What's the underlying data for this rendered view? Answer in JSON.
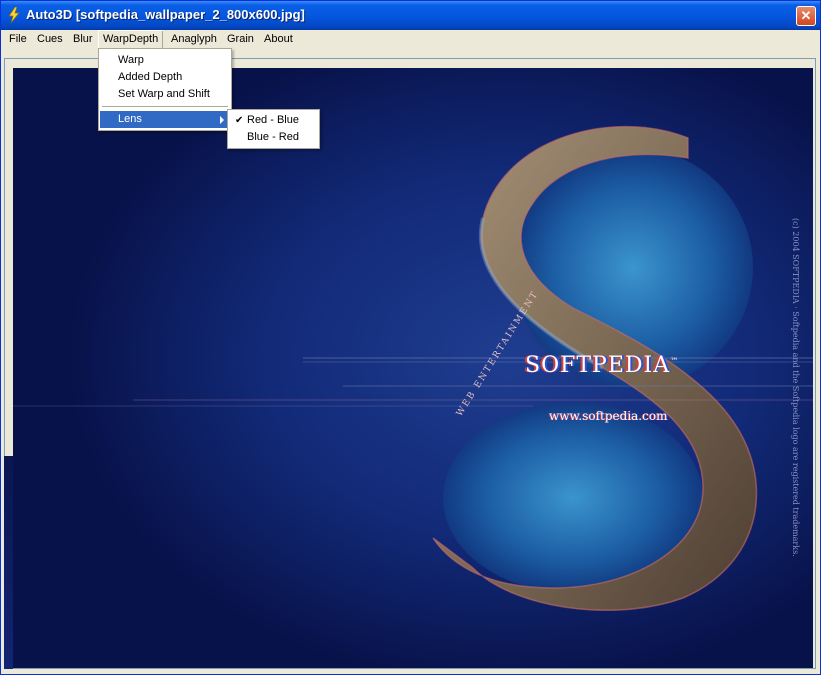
{
  "window": {
    "title": "Auto3D [softpedia_wallpaper_2_800x600.jpg]"
  },
  "menubar": {
    "items": [
      "File",
      "Cues",
      "Blur",
      "WarpDepth",
      "Anaglyph",
      "Grain",
      "About"
    ]
  },
  "warpdepth_menu": {
    "items": [
      "Warp",
      "Added Depth",
      "Set Warp and Shift"
    ],
    "lens_label": "Lens"
  },
  "lens_submenu": {
    "items": [
      "Red - Blue",
      "Blue - Red"
    ],
    "checked": "Red - Blue"
  },
  "wallpaper": {
    "brand": "SOFTPEDIA",
    "trademark": "™",
    "url": "www.softpedia.com",
    "tagline": "WEB ENTERTAINMENT",
    "legal": "(c) 2004 SOFTPEDIA · Softpedia and the Softpedia logo are registered trademarks."
  },
  "colors": {
    "titlebar": "#0557e0",
    "menu_highlight": "#316ac5",
    "canvas_bg": "#0a1650"
  }
}
